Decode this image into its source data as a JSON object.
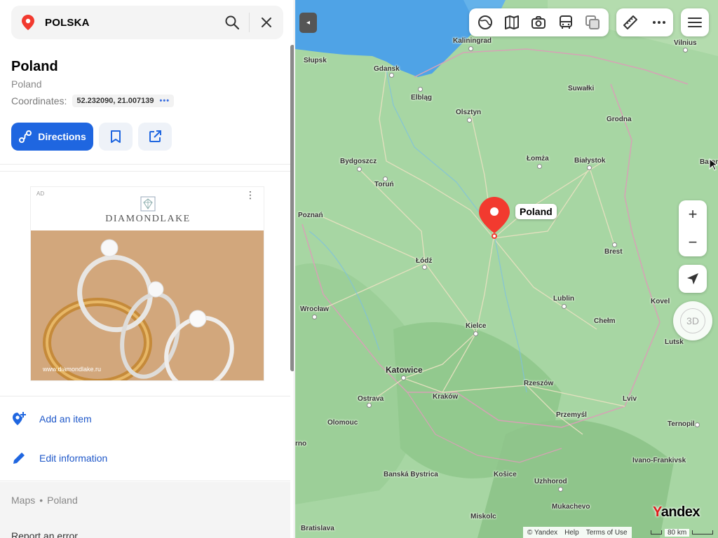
{
  "search": {
    "query": "POLSKA"
  },
  "place": {
    "title": "Poland",
    "subtitle": "Poland",
    "coordinates_label": "Coordinates:",
    "coordinates_value": "52.232090, 21.007139",
    "coordinates_more": "•••"
  },
  "actions": {
    "directions_label": "Directions"
  },
  "ad": {
    "badge": "AD",
    "menu": "⋮",
    "brand": "DIAMONDLAKE",
    "url": "www.diamondlake.ru"
  },
  "panel_actions": {
    "add_item": "Add an item",
    "edit_info": "Edit information"
  },
  "footer": {
    "crumb_1": "Maps",
    "crumb_sep": "•",
    "crumb_2": "Poland",
    "report": "Report an error"
  },
  "map": {
    "pin_label": "Poland",
    "zoom_in": "+",
    "zoom_out": "−",
    "btn_3d": "3D",
    "collapse": "◂",
    "brand_first": "Y",
    "brand_rest": "andex",
    "credit_copyright": "© Yandex",
    "credit_help": "Help",
    "credit_terms": "Terms of Use",
    "scale": "80 km",
    "cities": {
      "kaliningrad": "Kaliningrad",
      "vilnius": "Vilnius",
      "slupsk": "Słupsk",
      "gdansk": "Gdansk",
      "elblag": "Elbląg",
      "olsztyn": "Olsztyn",
      "suwalki": "Suwałki",
      "grodna": "Grodna",
      "bydgoszcz": "Bydgoszcz",
      "torun": "Toruń",
      "lomza": "Łomża",
      "bialystok": "Białystok",
      "baranovichi": "Baran",
      "poznan": "Poznań",
      "brest": "Brest",
      "lodz": "Łódź",
      "wroclaw": "Wrocław",
      "kielce": "Kielce",
      "lublin": "Lublin",
      "chelm": "Chełm",
      "kovel": "Kovel",
      "lutsk": "Lutsk",
      "katowice": "Katowice",
      "rzeszow": "Rzeszów",
      "ostrava": "Ostrava",
      "krakow": "Kraków",
      "lviv": "Lviv",
      "olomouc": "Olomouc",
      "przemysl": "Przemyśl",
      "ternopil": "Ternopil",
      "brno": "rno",
      "ivano": "Ivano-Frankivsk",
      "banska": "Banská Bystrica",
      "kosice": "Košice",
      "uzhhorod": "Uzhhorod",
      "mukachevo": "Mukachevo",
      "miskolc": "Miskolc",
      "bratislava": "Bratislava"
    }
  },
  "colors": {
    "accent": "#1f66e0",
    "pin": "#f23a2f",
    "map_land": "#a7d6a3",
    "map_water": "#4fa3e6"
  }
}
